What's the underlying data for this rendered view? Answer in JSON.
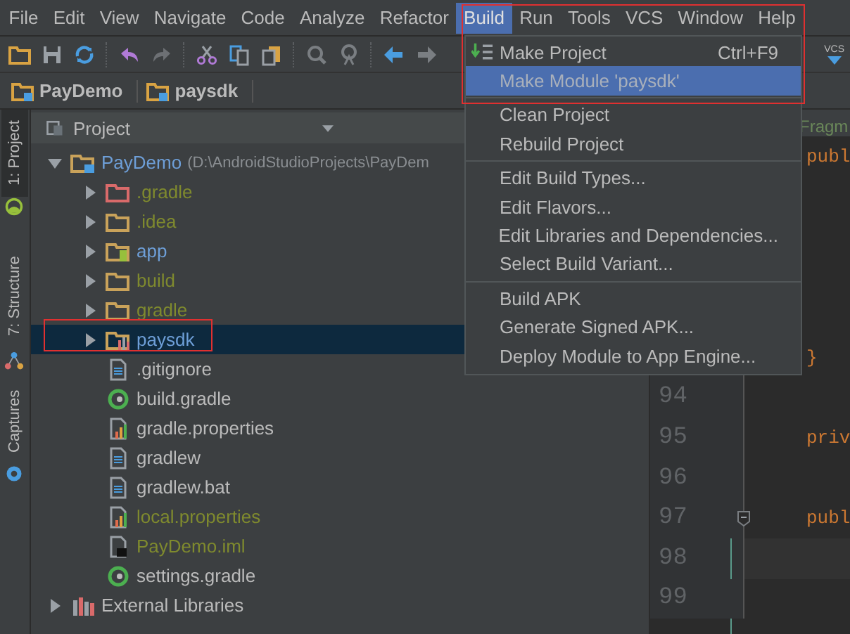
{
  "menu_bar": [
    {
      "label": "File",
      "selected": false
    },
    {
      "label": "Edit",
      "selected": false
    },
    {
      "label": "View",
      "selected": false
    },
    {
      "label": "Navigate",
      "selected": false
    },
    {
      "label": "Code",
      "selected": false
    },
    {
      "label": "Analyze",
      "selected": false
    },
    {
      "label": "Refactor",
      "selected": false
    },
    {
      "label": "Build",
      "selected": true
    },
    {
      "label": "Run",
      "selected": false
    },
    {
      "label": "Tools",
      "selected": false
    },
    {
      "label": "VCS",
      "selected": false
    },
    {
      "label": "Window",
      "selected": false
    },
    {
      "label": "Help",
      "selected": false
    }
  ],
  "toolbar": {
    "vcs_badge": "VCS"
  },
  "breadcrumb": [
    "PayDemo",
    "paysdk"
  ],
  "tool_strip": [
    {
      "label": "1: Project",
      "selected": true
    },
    {
      "label": "7: Structure",
      "selected": false
    },
    {
      "label": "Captures",
      "selected": false
    }
  ],
  "project_panel": {
    "title": "Project",
    "tree": [
      {
        "name": "PayDemo",
        "path": "(D:\\AndroidStudioProjects\\PayDem",
        "kind": "module",
        "expanded": true,
        "selected": false,
        "color": "#6e9fd8",
        "children": [
          {
            "name": ".gradle",
            "kind": "folder-excluded",
            "expanded": false,
            "selected": false,
            "color": "#7f8a2e"
          },
          {
            "name": ".idea",
            "kind": "folder",
            "expanded": false,
            "selected": false,
            "color": "#7f8a2e"
          },
          {
            "name": "app",
            "kind": "module",
            "expanded": false,
            "selected": false,
            "color": "#6e9fd8"
          },
          {
            "name": "build",
            "kind": "folder",
            "expanded": false,
            "selected": false,
            "color": "#7f8a2e"
          },
          {
            "name": "gradle",
            "kind": "folder",
            "expanded": false,
            "selected": false,
            "color": "#7f8a2e"
          },
          {
            "name": "paysdk",
            "kind": "library",
            "expanded": false,
            "selected": true,
            "color": "#6e9fd8"
          },
          {
            "name": ".gitignore",
            "kind": "text-file",
            "selected": false,
            "color": "#bbbbbb"
          },
          {
            "name": "build.gradle",
            "kind": "gradle-file",
            "selected": false,
            "color": "#bbbbbb"
          },
          {
            "name": "gradle.properties",
            "kind": "properties-file",
            "selected": false,
            "color": "#bbbbbb"
          },
          {
            "name": "gradlew",
            "kind": "text-file",
            "selected": false,
            "color": "#bbbbbb"
          },
          {
            "name": "gradlew.bat",
            "kind": "text-file",
            "selected": false,
            "color": "#bbbbbb"
          },
          {
            "name": "local.properties",
            "kind": "properties-file",
            "selected": false,
            "color": "#7f8a2e"
          },
          {
            "name": "PayDemo.iml",
            "kind": "iml-file",
            "selected": false,
            "color": "#7f8a2e"
          },
          {
            "name": "settings.gradle",
            "kind": "gradle-file",
            "selected": false,
            "color": "#bbbbbb"
          }
        ]
      },
      {
        "name": "External Libraries",
        "kind": "libraries",
        "expanded": false,
        "selected": false,
        "color": "#bbbbbb"
      }
    ]
  },
  "editor": {
    "tab": "Fragm",
    "lines": [
      {
        "code": "publ"
      },
      {
        "code": "}"
      },
      {
        "number": "94",
        "current": false
      },
      {
        "number": "95",
        "code": "priv",
        "current": false
      },
      {
        "number": "96",
        "current": false
      },
      {
        "number": "97",
        "code": "publ",
        "fold": true,
        "current": false
      },
      {
        "number": "98",
        "current": true
      },
      {
        "number": "99",
        "current": false
      }
    ]
  },
  "build_menu": {
    "groups": [
      [
        {
          "label": "Make Project",
          "shortcut": "Ctrl+F9",
          "kind": "make",
          "selected": false
        },
        {
          "label": "Make Module 'paysdk'",
          "kind": "plain",
          "selected": true
        }
      ],
      [
        {
          "label": "Clean Project",
          "kind": "plain",
          "selected": false
        },
        {
          "label": "Rebuild Project",
          "kind": "plain",
          "selected": false
        }
      ],
      [
        {
          "label": "Edit Build Types...",
          "kind": "plain",
          "selected": false
        },
        {
          "label": "Edit Flavors...",
          "kind": "plain",
          "selected": false
        },
        {
          "label": "Edit Libraries and Dependencies...",
          "kind": "plain",
          "selected": false
        },
        {
          "label": "Select Build Variant...",
          "kind": "plain",
          "selected": false
        }
      ],
      [
        {
          "label": "Build APK",
          "kind": "plain",
          "selected": false
        },
        {
          "label": "Generate Signed APK...",
          "kind": "plain",
          "selected": false
        },
        {
          "label": "Deploy Module to App Engine...",
          "kind": "plain",
          "selected": false
        }
      ]
    ]
  }
}
